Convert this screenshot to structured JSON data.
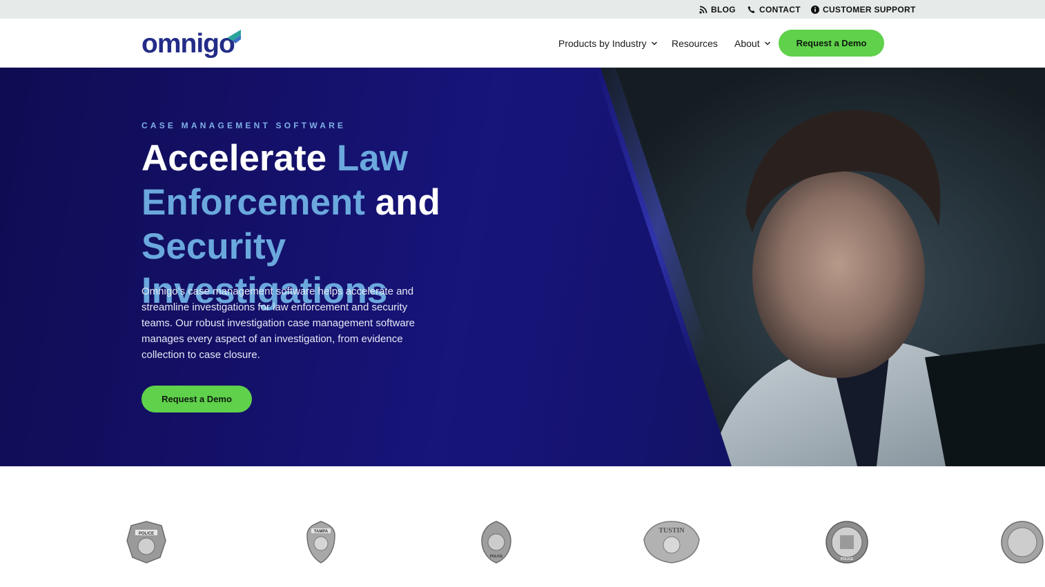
{
  "utility": {
    "blog": "BLOG",
    "contact": "CONTACT",
    "support": "CUSTOMER SUPPORT"
  },
  "header": {
    "logo_text": "omnigo",
    "nav": [
      {
        "label": "Products by Industry",
        "has_dropdown": true
      },
      {
        "label": "Resources",
        "has_dropdown": false
      },
      {
        "label": "About",
        "has_dropdown": true
      }
    ],
    "cta": "Request a Demo"
  },
  "hero": {
    "eyebrow": "CASE MANAGEMENT SOFTWARE",
    "headline_parts": [
      "Accelerate ",
      "Law",
      "Enforcement",
      " and ",
      "Security",
      "Investigations"
    ],
    "body": "Omnigo’s case management software helps accelerate and streamline investigations for law enforcement and security teams. Our robust investigation case management software manages every aspect of an investigation, from evidence collection to case closure.",
    "cta": "Request a Demo"
  },
  "logos": {
    "badge_labels": [
      "POLICE",
      "TAMPA",
      "POLICE",
      "TUSTIN",
      "POLICE",
      ""
    ]
  },
  "colors": {
    "brand_navy": "#232c87",
    "accent_green": "#5fd14a",
    "hero_highlight": "#6aa8dd"
  }
}
